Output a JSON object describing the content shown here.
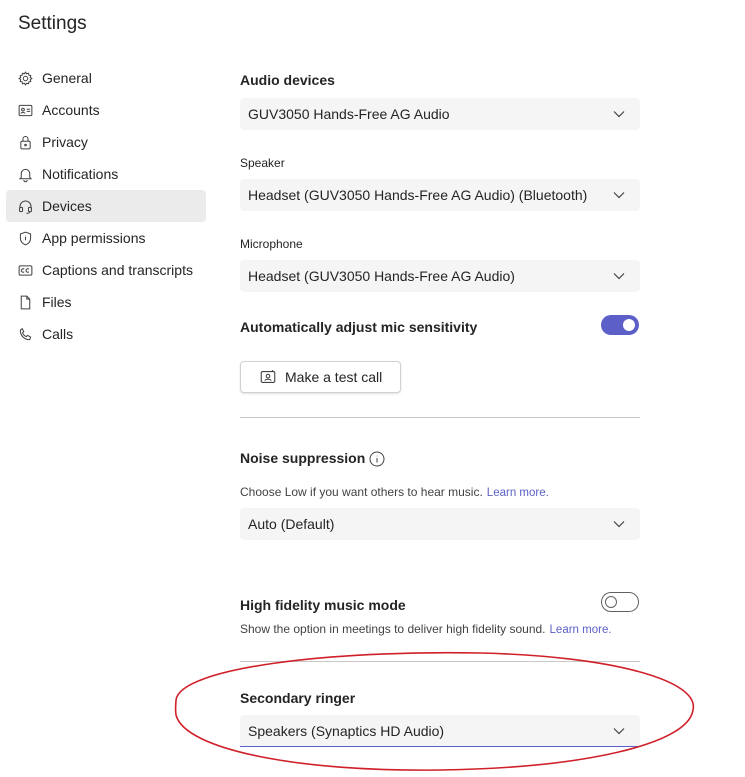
{
  "page": {
    "title": "Settings"
  },
  "sidebar": {
    "items": [
      {
        "label": "General",
        "icon": "gear-icon"
      },
      {
        "label": "Accounts",
        "icon": "id-card-icon"
      },
      {
        "label": "Privacy",
        "icon": "lock-icon"
      },
      {
        "label": "Notifications",
        "icon": "bell-icon"
      },
      {
        "label": "Devices",
        "icon": "headset-icon",
        "active": true
      },
      {
        "label": "App permissions",
        "icon": "shield-icon"
      },
      {
        "label": "Captions and transcripts",
        "icon": "cc-icon"
      },
      {
        "label": "Files",
        "icon": "file-icon"
      },
      {
        "label": "Calls",
        "icon": "phone-icon"
      }
    ]
  },
  "audio": {
    "heading": "Audio devices",
    "device_value": "GUV3050 Hands-Free AG Audio",
    "speaker_label": "Speaker",
    "speaker_value": "Headset (GUV3050 Hands-Free AG Audio) (Bluetooth)",
    "mic_label": "Microphone",
    "mic_value": "Headset (GUV3050 Hands-Free AG Audio)",
    "auto_adjust_label": "Automatically adjust mic sensitivity",
    "auto_adjust_on": true,
    "test_call_label": "Make a test call"
  },
  "noise": {
    "heading": "Noise suppression",
    "description": "Choose Low if you want others to hear music.",
    "learn_more": "Learn more.",
    "value": "Auto (Default)"
  },
  "hifi": {
    "heading": "High fidelity music mode",
    "description": "Show the option in meetings to deliver high fidelity sound.",
    "learn_more": "Learn more.",
    "on": false
  },
  "ringer": {
    "heading": "Secondary ringer",
    "value": "Speakers (Synaptics HD Audio)"
  },
  "colors": {
    "accent": "#5b5fc7",
    "annotation": "#d0202a",
    "active_nav_bg": "#ebebeb"
  }
}
